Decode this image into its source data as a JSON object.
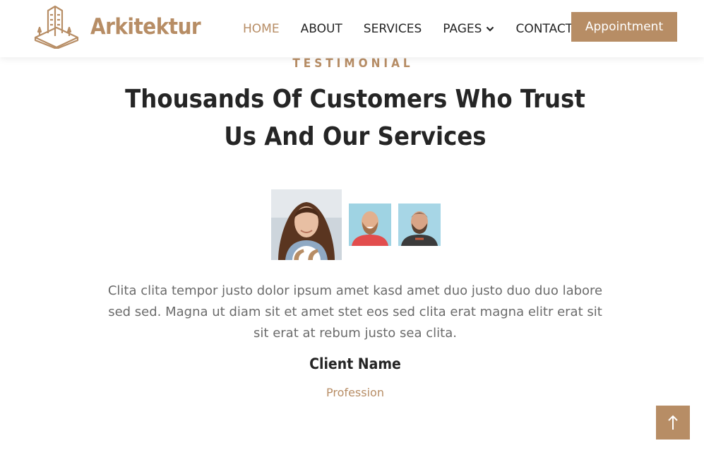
{
  "brand": {
    "name": "Arkitektur",
    "logo_icon": "building-outline-icon"
  },
  "nav": {
    "items": [
      {
        "label": "HOME",
        "active": true
      },
      {
        "label": "ABOUT",
        "active": false
      },
      {
        "label": "SERVICES",
        "active": false
      },
      {
        "label": "PAGES",
        "active": false,
        "dropdown": true
      },
      {
        "label": "CONTACT",
        "active": false
      }
    ],
    "cta_label": "Appointment"
  },
  "testimonial": {
    "eyebrow": "TESTIMONIAL",
    "heading": "Thousands Of Customers Who Trust Us And Our Services",
    "text": "Clita clita tempor justo dolor ipsum amet kasd amet duo justo duo duo labore sed sed. Magna ut diam sit et amet stet eos sed clita erat magna elitr erat sit sit erat at rebum justo sea clita.",
    "client_name": "Client Name",
    "profession": "Profession",
    "avatars": [
      "client-photo-woman",
      "client-photo-man-smiling",
      "client-photo-man-beard"
    ],
    "quote_icon": "quote-left-icon"
  },
  "back_to_top_icon": "arrow-up-icon",
  "colors": {
    "accent": "#b78d65",
    "text": "#252525",
    "muted": "#6b6b6b"
  }
}
